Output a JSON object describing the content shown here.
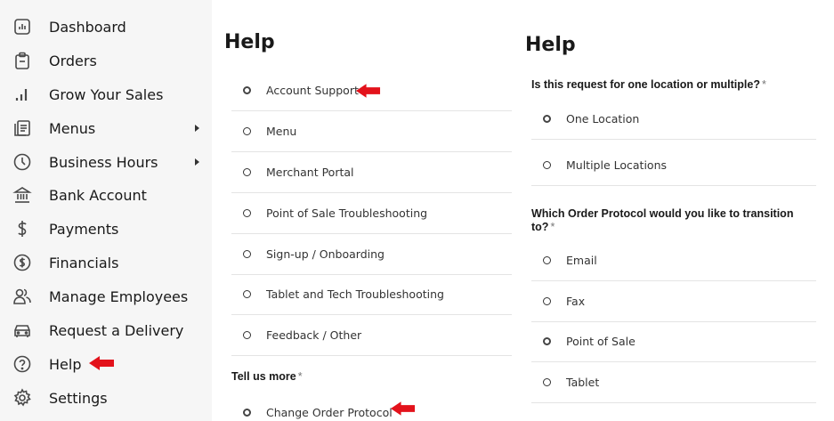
{
  "sidebar": {
    "items": [
      {
        "label": "Dashboard",
        "icon": "dashboard-icon",
        "chevron": false
      },
      {
        "label": "Orders",
        "icon": "orders-icon",
        "chevron": false
      },
      {
        "label": "Grow Your Sales",
        "icon": "bar-chart-icon",
        "chevron": false
      },
      {
        "label": "Menus",
        "icon": "menu-list-icon",
        "chevron": true
      },
      {
        "label": "Business Hours",
        "icon": "clock-icon",
        "chevron": true
      },
      {
        "label": "Bank Account",
        "icon": "bank-icon",
        "chevron": false
      },
      {
        "label": "Payments",
        "icon": "dollar-icon",
        "chevron": false
      },
      {
        "label": "Financials",
        "icon": "dollar-circle-icon",
        "chevron": false
      },
      {
        "label": "Manage Employees",
        "icon": "people-icon",
        "chevron": false
      },
      {
        "label": "Request a Delivery",
        "icon": "car-icon",
        "chevron": false
      },
      {
        "label": "Help",
        "icon": "help-icon",
        "chevron": false
      },
      {
        "label": "Settings",
        "icon": "gear-icon",
        "chevron": false
      }
    ]
  },
  "left_panel": {
    "title": "Help",
    "options": [
      {
        "label": "Account Support",
        "selected": true
      },
      {
        "label": "Menu",
        "selected": false
      },
      {
        "label": "Merchant Portal",
        "selected": false
      },
      {
        "label": "Point of Sale Troubleshooting",
        "selected": false
      },
      {
        "label": "Sign-up / Onboarding",
        "selected": false
      },
      {
        "label": "Tablet and Tech Troubleshooting",
        "selected": false
      },
      {
        "label": "Feedback / Other",
        "selected": false
      }
    ],
    "tell_more": {
      "label": "Tell us more",
      "required": "*"
    },
    "tell_more_selected": "Change Order Protocol"
  },
  "right_panel": {
    "title": "Help",
    "q1": {
      "label": "Is this request for one location or multiple?",
      "required": "*",
      "options": [
        {
          "label": "One Location",
          "selected": true
        },
        {
          "label": "Multiple Locations",
          "selected": false
        }
      ]
    },
    "q2": {
      "label_line1": "Which Order Protocol would you like to transition",
      "label_line2": "to?",
      "required": "*",
      "options": [
        {
          "label": "Email",
          "selected": false
        },
        {
          "label": "Fax",
          "selected": false
        },
        {
          "label": "Point of Sale",
          "selected": true
        },
        {
          "label": "Tablet",
          "selected": false
        }
      ]
    }
  },
  "colors": {
    "annotation_arrow": "#e3121b",
    "sidebar_bg": "#f6f6f6",
    "divider": "#e4e4e4"
  }
}
